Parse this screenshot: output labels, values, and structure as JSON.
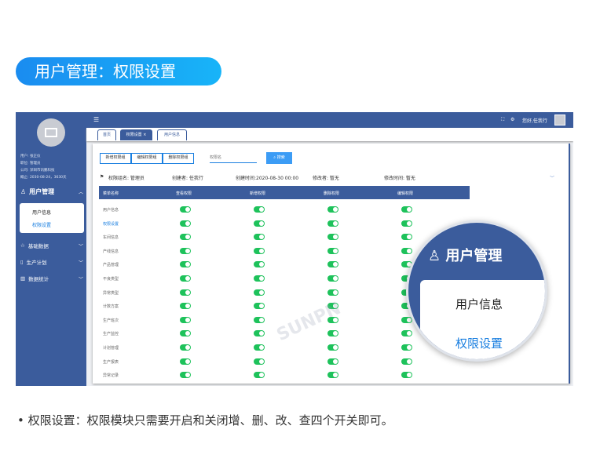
{
  "banner": "用户管理：权限设置",
  "sidebar": {
    "user": "用户: 张正仪",
    "position": "职位: 管理员",
    "company": "公司: 深圳市讯鹏科技",
    "expiry": "概止: 2030-08-24，3630天",
    "menu": [
      {
        "label": "用户管理"
      },
      {
        "label": "基础数据"
      },
      {
        "label": "生产计划"
      },
      {
        "label": "数据统计"
      }
    ],
    "submenu": [
      "用户信息",
      "权限设置"
    ]
  },
  "topbar": {
    "greeting": "您好,任我行"
  },
  "tabs": [
    "首页",
    "权限设置",
    "用户信息"
  ],
  "toolbar": {
    "add": "新增权限组",
    "edit": "编辑权限组",
    "delete": "删除权限组",
    "search_placeholder": "权限名",
    "search": "搜索"
  },
  "meta": {
    "group": "权限组名: 管理员",
    "creator": "创建者: 任我行",
    "created": "创建时间:2020-08-30 00:00",
    "modifier": "修改者: 暂无",
    "modified": "修改时间: 暂无"
  },
  "table": {
    "headers": [
      "菜单名称",
      "查看权限",
      "新增权限",
      "删除权限",
      "编辑权限"
    ],
    "rows": [
      "用户信息",
      "权限设置",
      "车间信息",
      "产线信息",
      "产品管理",
      "不良类型",
      "异常类型",
      "计数方案",
      "生产班次",
      "生产监控",
      "计划管理",
      "生产报表",
      "异常记录"
    ]
  },
  "magnifier": {
    "title": "用户管理",
    "item1": "用户信息",
    "item2": "权限设置"
  },
  "watermark": "SUNPN 讯鹏",
  "footer": "• 权限设置：权限模块只需要开启和关闭增、删、改、查四个开关即可。"
}
